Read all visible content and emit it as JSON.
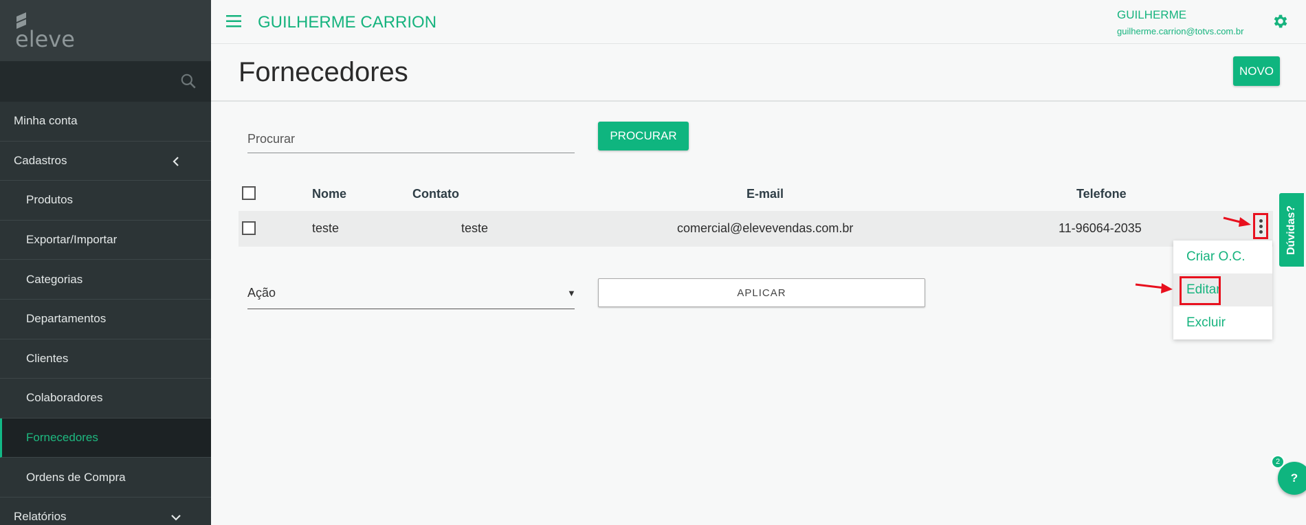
{
  "sidebar": {
    "logo_text": "eleve",
    "items": [
      {
        "label": "Minha conta",
        "level": "top"
      },
      {
        "label": "Cadastros",
        "level": "top",
        "chevron": "chevron-left"
      },
      {
        "label": "Produtos",
        "level": "sub"
      },
      {
        "label": "Exportar/Importar",
        "level": "sub"
      },
      {
        "label": "Categorias",
        "level": "sub"
      },
      {
        "label": "Departamentos",
        "level": "sub"
      },
      {
        "label": "Clientes",
        "level": "sub"
      },
      {
        "label": "Colaboradores",
        "level": "sub"
      },
      {
        "label": "Fornecedores",
        "level": "sub",
        "active": true
      },
      {
        "label": "Ordens de Compra",
        "level": "sub"
      },
      {
        "label": "Relatórios",
        "level": "top",
        "chevron": "chevron-down"
      }
    ]
  },
  "topbar": {
    "title": "GUILHERME CARRION",
    "user_name": "GUILHERME",
    "user_email": "guilherme.carrion@totvs.com.br"
  },
  "page": {
    "title": "Fornecedores",
    "new_button": "NOVO"
  },
  "search": {
    "placeholder": "Procurar",
    "button": "PROCURAR"
  },
  "table": {
    "headers": {
      "nome": "Nome",
      "contato": "Contato",
      "email": "E-mail",
      "telefone": "Telefone"
    },
    "rows": [
      {
        "nome": "teste",
        "contato": "teste",
        "email": "comercial@elevevendas.com.br",
        "telefone": "11-96064-2035"
      }
    ]
  },
  "row_menu": {
    "items": [
      "Criar O.C.",
      "Editar",
      "Excluir"
    ]
  },
  "actions": {
    "select_label": "Ação",
    "apply_button": "APLICAR"
  },
  "help": {
    "tab_label": "Dúvidas?",
    "fab_label": "?",
    "badge_count": "2"
  },
  "colors": {
    "brand_green": "#0fb57f",
    "sidebar_bg": "#2c3436",
    "annotation_red": "#e8101e"
  }
}
